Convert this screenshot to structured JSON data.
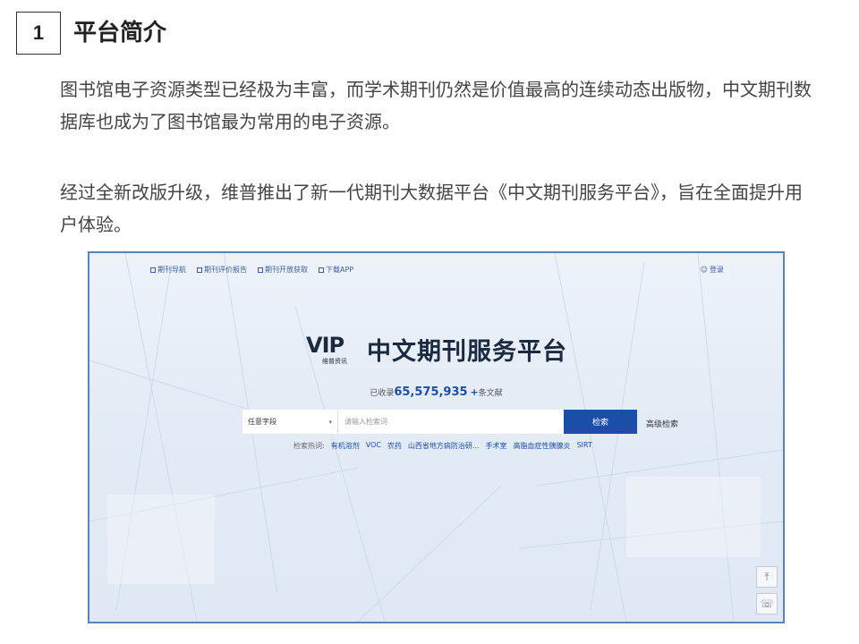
{
  "section": {
    "number": "1",
    "title": "平台简介"
  },
  "paragraphs": {
    "p1": "图书馆电子资源类型已经极为丰富，而学术期刊仍然是价值最高的连续动态出版物，中文期刊数据库也成为了图书馆最为常用的电子资源。",
    "p2": "经过全新改版升级，维普推出了新一代期刊大数据平台《中文期刊服务平台》，旨在全面提升用户体验。"
  },
  "screenshot": {
    "nav": [
      "期刊导航",
      "期刊评价报告",
      "期刊开放获取",
      "下载APP"
    ],
    "login": "登录",
    "logo_text": "VIP",
    "logo_sub": "维普资讯",
    "platform_title": "中文期刊服务平台",
    "count_prefix": "已收录",
    "count_value": "65,575,935",
    "count_plus": "+",
    "count_suffix": "条文献",
    "search_scope": "任意字段",
    "search_placeholder": "请输入检索词",
    "search_button": "检索",
    "advanced_search": "高级检索",
    "hot_label": "检索热词:",
    "hot_terms": [
      "有机溶剂",
      "VOC",
      "农药",
      "山西省地方病防治研...",
      "手术室",
      "高脂血症性胰腺炎",
      "SIRT"
    ],
    "side_top": "⤒",
    "side_chat": "☏"
  }
}
